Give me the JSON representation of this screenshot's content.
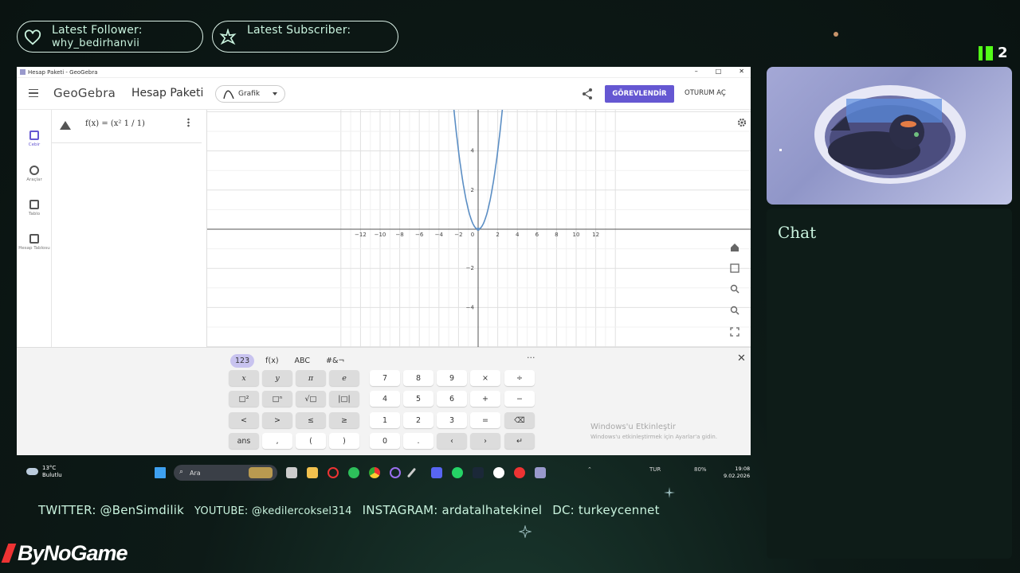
{
  "overlay": {
    "follower_label": "Latest Follower:",
    "follower_name": "why_bedirhanvii",
    "subscriber_label": "Latest Subscriber:",
    "subscriber_name": "",
    "kick_count": "2",
    "chat_title": "Chat",
    "socials": [
      "TWITTER: @BenSimdilik",
      "YOUTUBE: @kedilercoksel314",
      "INSTAGRAM: ardatalhatekinel",
      "DC: turkeycennet"
    ],
    "brand": "ByNoGame"
  },
  "window": {
    "title": "Hesap Paketi - GeoGebra",
    "controls": [
      "–",
      "□",
      "✕"
    ]
  },
  "app": {
    "logo": "GeoGebra",
    "name": "Hesap Paketi",
    "view_select": "Grafik",
    "assign_button": "GÖREVLENDİR",
    "login_button": "OTURUM AÇ",
    "rail": [
      "Cebir",
      "Araçlar",
      "Tablo",
      "Hesap Tablosu"
    ]
  },
  "algebra": {
    "input_formula": "f(x) = (x² 1 / 1)"
  },
  "graph": {
    "x_ticks": [
      -12,
      -10,
      -8,
      -6,
      -4,
      -2,
      0,
      2,
      4,
      6,
      8,
      10,
      12
    ],
    "y_ticks": [
      4,
      2,
      -2,
      -4
    ],
    "curve": "parabola through the origin",
    "grid": true
  },
  "keyboard": {
    "tabs": [
      "123",
      "f(x)",
      "ABC",
      "#&¬"
    ],
    "more": "···",
    "close": "✕",
    "rows": [
      [
        "x",
        "y",
        "π",
        "e",
        "7",
        "8",
        "9",
        "×",
        "÷"
      ],
      [
        "□²",
        "□ⁿ",
        "√□",
        "|□|",
        "4",
        "5",
        "6",
        "+",
        "−"
      ],
      [
        "<",
        ">",
        "≤",
        "≥",
        "1",
        "2",
        "3",
        "=",
        "⌫"
      ],
      [
        "ans",
        ",",
        "(",
        ")",
        "0",
        ".",
        "‹",
        "›",
        "↵"
      ]
    ]
  },
  "watermark": {
    "title": "Windows'u Etkinleştir",
    "subtitle": "Windows'u etkinleştirmek için Ayarlar'a gidin."
  },
  "taskbar": {
    "temp": "13°C",
    "weather": "Bulutlu",
    "search": "Ara",
    "lang": "TUR",
    "battery": "80%",
    "time": "19:08",
    "date": "9.02.2026"
  }
}
